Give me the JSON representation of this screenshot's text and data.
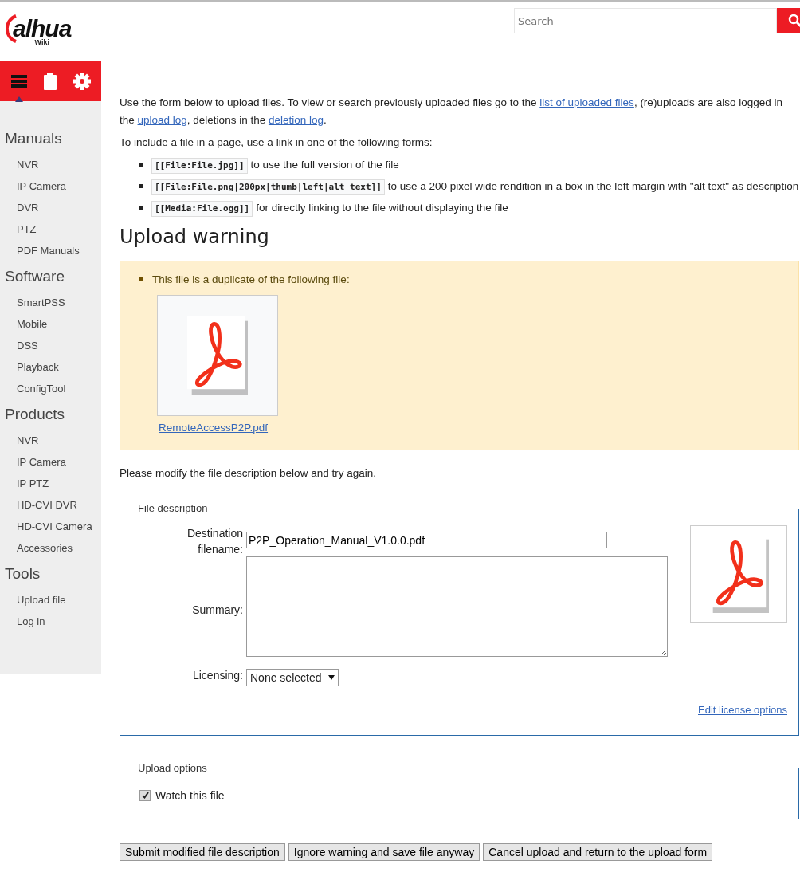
{
  "logo": {
    "text": "alhua",
    "subtitle": "Wiki"
  },
  "search": {
    "placeholder": "Search"
  },
  "toolbar": [
    {
      "kind": "menu",
      "selected": true
    },
    {
      "kind": "clipboard",
      "selected": false
    },
    {
      "kind": "settings",
      "selected": false
    }
  ],
  "sidebar": [
    {
      "heading": "Manuals",
      "items": [
        "NVR",
        "IP Camera",
        "DVR",
        "PTZ",
        "PDF Manuals"
      ]
    },
    {
      "heading": "Software",
      "items": [
        "SmartPSS",
        "Mobile",
        "DSS",
        "Playback",
        "ConfigTool"
      ]
    },
    {
      "heading": "Products",
      "items": [
        "NVR",
        "IP Camera",
        "IP PTZ",
        "HD-CVI DVR",
        "HD-CVI Camera",
        "Accessories"
      ]
    },
    {
      "heading": "Tools",
      "items": [
        "Upload file",
        "Log in"
      ]
    }
  ],
  "intro": [
    {
      "kind": "text",
      "text": "Use the form below to upload files. To view or search previously uploaded files go to the "
    },
    {
      "kind": "link",
      "text": "list of uploaded files"
    },
    {
      "kind": "text",
      "text": ", (re)uploads are also logged in the "
    },
    {
      "kind": "link",
      "text": "upload log"
    },
    {
      "kind": "text",
      "text": ", deletions in the "
    },
    {
      "kind": "link",
      "text": "deletion log"
    },
    {
      "kind": "text",
      "text": "."
    }
  ],
  "include_text": "To include a file in a page, use a link in one of the following forms:",
  "forms": [
    {
      "code": "[[File:File.jpg]]",
      "text": "to use the full version of the file"
    },
    {
      "code": "[[File:File.png|200px|thumb|left|alt text]]",
      "text": "to use a 200 pixel wide rendition in a box in the left margin with \"alt text\" as description"
    },
    {
      "code": "[[Media:File.ogg]]",
      "text": "for directly linking to the file without displaying the file"
    }
  ],
  "warning": {
    "heading": "Upload warning",
    "message": "This file is a duplicate of the following file:",
    "file": "RemoteAccessP2P.pdf"
  },
  "retry_text": "Please modify the file description below and try again.",
  "file_description": {
    "legend": "File description",
    "destination_label": "Destination filename:",
    "destination_value": "P2P_Operation_Manual_V1.0.0.pdf",
    "summary_label": "Summary:",
    "licensing_label": "Licensing:",
    "licensing_value": "None selected",
    "license_link": "Edit license options"
  },
  "upload_options": {
    "legend": "Upload options",
    "watch_label": "Watch this file",
    "watch_checked": true
  },
  "buttons": [
    "Submit modified file description",
    "Ignore warning and save file anyway",
    "Cancel upload and return to the upload form"
  ]
}
